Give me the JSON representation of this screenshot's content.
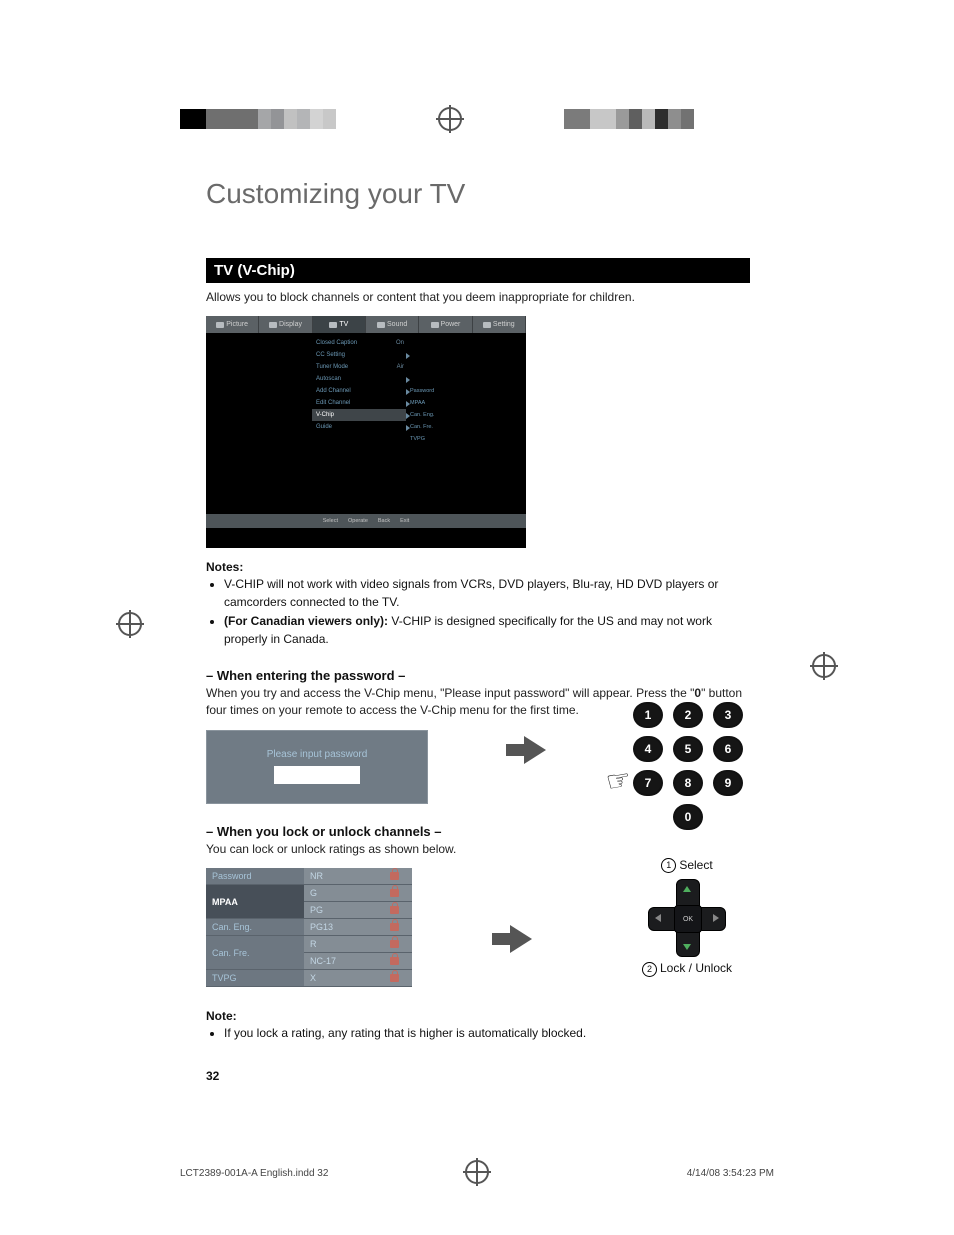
{
  "title": "Customizing your TV",
  "section_bar": "TV (V-Chip)",
  "intro": "Allows you to block channels or content that you deem inappropriate for children.",
  "osd": {
    "tabs": [
      "Picture",
      "Display",
      "TV",
      "Sound",
      "Power",
      "Setting"
    ],
    "items": [
      {
        "label": "Closed Caption",
        "value": "On",
        "arrow": false
      },
      {
        "label": "CC Setting",
        "value": "",
        "arrow": true
      },
      {
        "label": "Tuner Mode",
        "value": "Air",
        "arrow": false
      },
      {
        "label": "Autoscan",
        "value": "",
        "arrow": true
      },
      {
        "label": "Add Channel",
        "value": "",
        "arrow": true
      },
      {
        "label": "Edit Channel",
        "value": "",
        "arrow": true
      },
      {
        "label": "V-Chip",
        "value": "",
        "arrow": true,
        "selected": true
      },
      {
        "label": "Guide",
        "value": "",
        "arrow": true
      }
    ],
    "submenu": [
      "Password",
      "MPAA",
      "Can. Eng.",
      "Can. Fre.",
      "TVPG"
    ],
    "foot": [
      "Select",
      "Operate",
      "Back",
      "Exit"
    ]
  },
  "notes_heading": "Notes:",
  "notes": [
    "V-CHIP will not work with video signals from VCRs, DVD players, Blu-ray, HD DVD players or camcorders connected to the TV.",
    "(For Canadian viewers only):  V-CHIP is designed specifically for the US and may not work properly in Canada."
  ],
  "notes_bold2": "(For Canadian viewers only):",
  "h_pw": "– When entering the password –",
  "pw_para_a": "When you try and access the V-Chip menu, \"Please input password\" will appear.  Press the \"",
  "pw_para_b": "0",
  "pw_para_c": "\" button four times on your remote to access the V-Chip menu for the first time.",
  "pw_box_text": "Please input password",
  "keypad": [
    "1",
    "2",
    "3",
    "4",
    "5",
    "6",
    "7",
    "8",
    "9",
    "0"
  ],
  "h_lock": "– When you lock or unlock channels –",
  "lock_para": "You can lock or unlock ratings as shown below.",
  "lock_left": [
    "Password",
    "MPAA",
    "Can. Eng.",
    "Can. Fre.",
    "TVPG"
  ],
  "lock_ratings": [
    "NR",
    "G",
    "PG",
    "PG13",
    "R",
    "NC-17",
    "X"
  ],
  "dpad": {
    "select": "Select",
    "ok": "OK",
    "lockunlock": "Lock / Unlock",
    "n1": "1",
    "n2": "2"
  },
  "note2_h": "Note:",
  "note2": "If you lock a rating, any rating that is higher is automatically blocked.",
  "page_num": "32",
  "footer_left": "LCT2389-001A-A English.indd   32",
  "footer_right": "4/14/08   3:54:23 PM"
}
